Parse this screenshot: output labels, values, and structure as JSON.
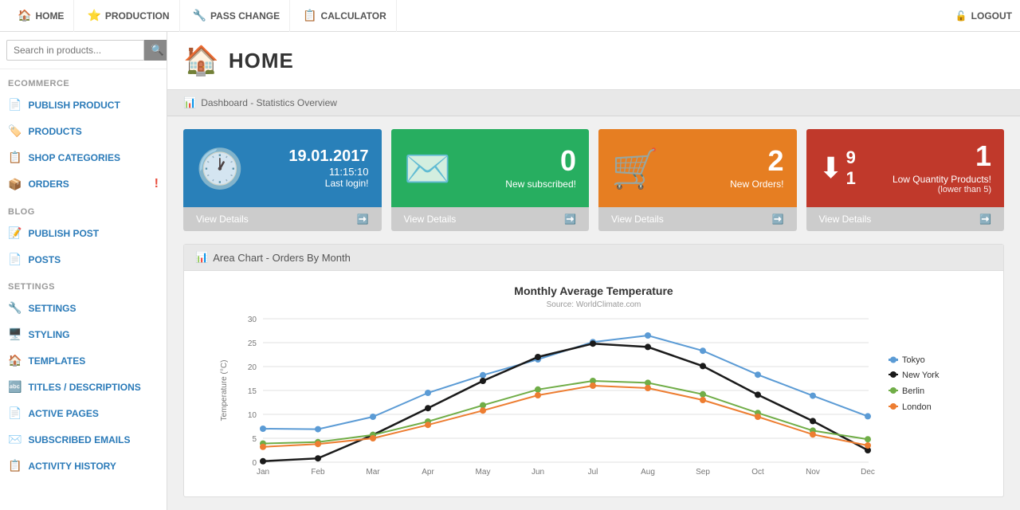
{
  "topnav": {
    "items": [
      {
        "label": "HOME",
        "icon": "🏠",
        "name": "home"
      },
      {
        "label": "PRODUCTION",
        "icon": "⭐",
        "name": "production"
      },
      {
        "label": "PASS CHANGE",
        "icon": "🔧",
        "name": "pass-change"
      },
      {
        "label": "CALCULATOR",
        "icon": "📋",
        "name": "calculator"
      }
    ],
    "logout_label": "LOGOUT",
    "logout_icon": "🔓"
  },
  "sidebar": {
    "search_placeholder": "Search in products...",
    "sections": [
      {
        "label": "ECOMMERCE",
        "items": [
          {
            "label": "PUBLISH PRODUCT",
            "icon": "📄",
            "name": "publish-product"
          },
          {
            "label": "PRODUCTS",
            "icon": "🏷️",
            "name": "products"
          },
          {
            "label": "SHOP CATEGORIES",
            "icon": "📋",
            "name": "shop-categories",
            "badge": null
          },
          {
            "label": "ORDERS",
            "icon": "📦",
            "name": "orders",
            "badge": "!"
          }
        ]
      },
      {
        "label": "BLOG",
        "items": [
          {
            "label": "PUBLISH POST",
            "icon": "📝",
            "name": "publish-post"
          },
          {
            "label": "POSTS",
            "icon": "📄",
            "name": "posts"
          }
        ]
      },
      {
        "label": "SETTINGS",
        "items": [
          {
            "label": "SETTINGS",
            "icon": "🔧",
            "name": "settings"
          },
          {
            "label": "STYLING",
            "icon": "🖥️",
            "name": "styling"
          },
          {
            "label": "TEMPLATES",
            "icon": "🏠",
            "name": "templates"
          },
          {
            "label": "TITLES / DESCRIPTIONS",
            "icon": "🔤",
            "name": "titles-descriptions"
          },
          {
            "label": "ACTIVE PAGES",
            "icon": "📄",
            "name": "active-pages"
          },
          {
            "label": "SUBSCRIBED EMAILS",
            "icon": "✉️",
            "name": "subscribed-emails"
          },
          {
            "label": "ACTIVITY HISTORY",
            "icon": "📋",
            "name": "activity-history"
          }
        ]
      }
    ]
  },
  "page": {
    "title": "HOME",
    "breadcrumb": "Dashboard - Statistics Overview"
  },
  "cards": [
    {
      "type": "login",
      "color": "blue",
      "date": "19.01.2017",
      "time": "11:15:10",
      "label": "Last login!",
      "footer": "View Details"
    },
    {
      "type": "subscribed",
      "color": "green",
      "number": "0",
      "subtitle": "New subscribed!",
      "footer": "View Details"
    },
    {
      "type": "orders",
      "color": "orange",
      "number": "2",
      "subtitle": "New Orders!",
      "footer": "View Details"
    },
    {
      "type": "lowqty",
      "color": "red",
      "num_big": "1",
      "nums_small": [
        "9",
        "1"
      ],
      "subtitle": "Low Quantity Products!",
      "note": "(lower than 5)",
      "footer": "View Details"
    }
  ],
  "chart": {
    "header_icon": "📊",
    "header_label": "Area Chart - Orders By Month",
    "title": "Monthly Average Temperature",
    "source": "Source: WorldClimate.com",
    "y_label": "Temperature (°C)",
    "y_max": 30,
    "y_ticks": [
      0,
      5,
      10,
      15,
      20,
      25,
      30
    ],
    "x_labels": [
      "Jan",
      "Feb",
      "Mar",
      "Apr",
      "May",
      "Jun",
      "Jul",
      "Aug",
      "Sep",
      "Oct",
      "Nov",
      "Dec"
    ],
    "legend": [
      {
        "label": "Tokyo",
        "color": "#5b9bd5"
      },
      {
        "label": "New York",
        "color": "#1a1a1a"
      },
      {
        "label": "Berlin",
        "color": "#70ad47"
      },
      {
        "label": "London",
        "color": "#ed7d31"
      }
    ],
    "series": {
      "Tokyo": [
        7,
        6.9,
        9.5,
        14.5,
        18.2,
        21.5,
        25.2,
        26.5,
        23.3,
        18.3,
        13.9,
        9.6
      ],
      "New_York": [
        0.2,
        0.8,
        5.7,
        11.3,
        17,
        22,
        24.8,
        24.1,
        20.1,
        14.1,
        8.6,
        2.5
      ],
      "Berlin": [
        3.9,
        4.2,
        5.7,
        8.5,
        11.9,
        15.2,
        17,
        16.6,
        14.2,
        10.3,
        6.6,
        4.8
      ],
      "London": [
        3.9,
        4.2,
        5.7,
        8.5,
        11.9,
        15.2,
        17,
        16.6,
        14.2,
        10.3,
        6.6,
        4.8
      ]
    }
  }
}
